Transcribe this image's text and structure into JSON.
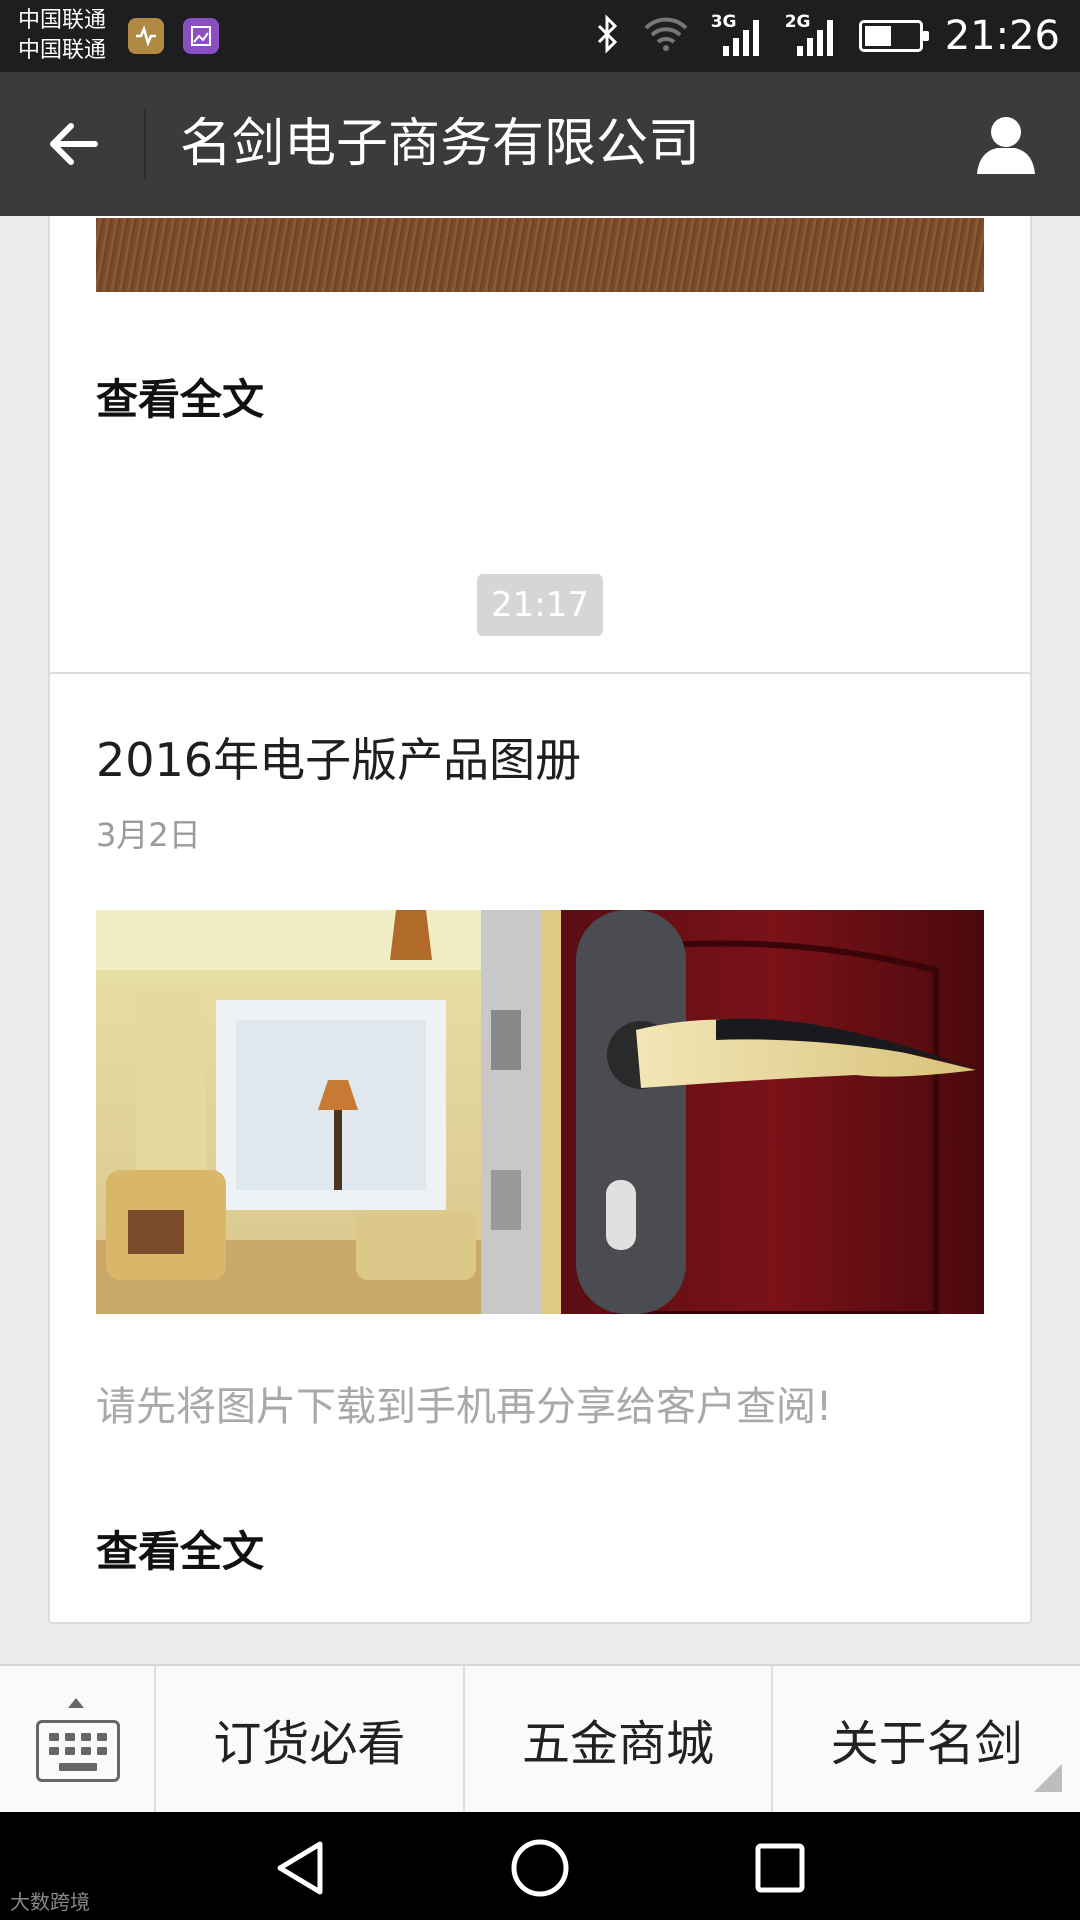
{
  "status_bar": {
    "carrier_1": "中国联通",
    "carrier_2": "中国联通",
    "network_1": "3G",
    "network_2": "2G",
    "time": "21:26"
  },
  "header": {
    "title": "名剑电子商务有限公司"
  },
  "messages": {
    "previous_card": {
      "read_more": "查看全文"
    },
    "timestamp": "21:17",
    "article": {
      "title": "2016年电子版产品图册",
      "date": "3月2日",
      "description": "请先将图片下载到手机再分享给客户查阅!",
      "read_more": "查看全文"
    }
  },
  "menu": {
    "items": [
      "订货必看",
      "五金商城",
      "关于名剑"
    ]
  },
  "watermark": "大数跨境",
  "colors": {
    "title_bar": "#3a3b3d",
    "status_bar": "#1e1e20",
    "background": "#ebebeb",
    "card": "#ffffff"
  }
}
